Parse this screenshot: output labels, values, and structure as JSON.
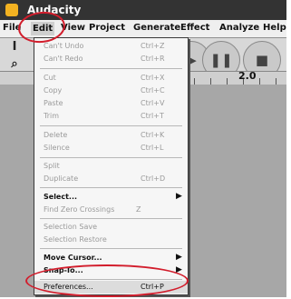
{
  "window": {
    "title": "Audacity",
    "icon": "app-icon"
  },
  "menubar": {
    "items": [
      "File",
      "Edit",
      "View",
      "Project",
      "Generate",
      "Effect",
      "Analyze",
      "Help"
    ],
    "open_item": "Edit"
  },
  "toolbar": {
    "tools": [
      "selection-tool-icon",
      "zoom-tool-icon"
    ],
    "transport": [
      "play-button",
      "pause-button",
      "stop-button"
    ],
    "ruler_label": "2.0"
  },
  "edit_menu": {
    "items": [
      {
        "label": "Can't Undo",
        "shortcut": "Ctrl+Z",
        "enabled": false
      },
      {
        "label": "Can't Redo",
        "shortcut": "Ctrl+R",
        "enabled": false
      },
      {
        "label": "Cut",
        "shortcut": "Ctrl+X",
        "enabled": false
      },
      {
        "label": "Copy",
        "shortcut": "Ctrl+C",
        "enabled": false
      },
      {
        "label": "Paste",
        "shortcut": "Ctrl+V",
        "enabled": false
      },
      {
        "label": "Trim",
        "shortcut": "Ctrl+T",
        "enabled": false
      },
      {
        "label": "Delete",
        "shortcut": "Ctrl+K",
        "enabled": false
      },
      {
        "label": "Silence",
        "shortcut": "Ctrl+L",
        "enabled": false
      },
      {
        "label": "Split",
        "shortcut": "",
        "enabled": false
      },
      {
        "label": "Duplicate",
        "shortcut": "Ctrl+D",
        "enabled": false
      },
      {
        "label": "Select...",
        "shortcut": "",
        "enabled": true,
        "submenu": true
      },
      {
        "label": "Find Zero Crossings",
        "shortcut": "Z",
        "enabled": false
      },
      {
        "label": "Selection Save",
        "shortcut": "",
        "enabled": false
      },
      {
        "label": "Selection Restore",
        "shortcut": "",
        "enabled": false
      },
      {
        "label": "Move Cursor...",
        "shortcut": "",
        "enabled": true,
        "submenu": true
      },
      {
        "label": "Snap-To...",
        "shortcut": "",
        "enabled": true,
        "submenu": true
      },
      {
        "label": "Preferences...",
        "shortcut": "Ctrl+P",
        "enabled": true
      }
    ]
  },
  "annotations": {
    "color": "#d21d2c",
    "circled": [
      "Edit",
      "Preferences..."
    ]
  }
}
